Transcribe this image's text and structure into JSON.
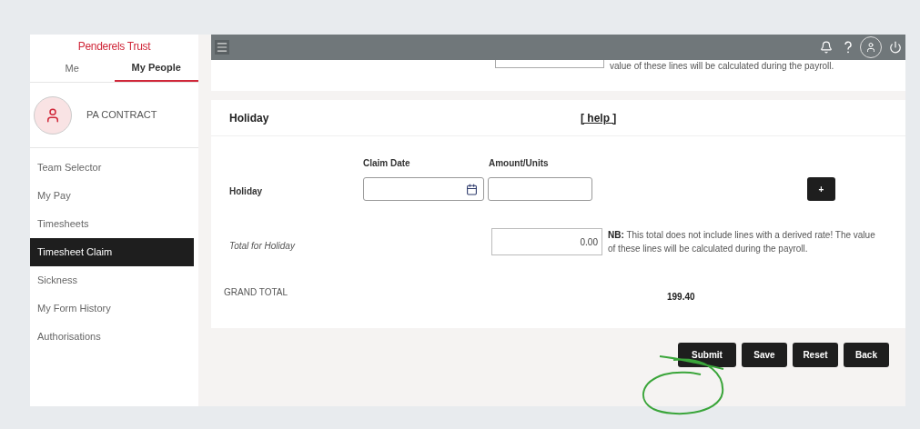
{
  "logo": "Penderels Trust",
  "tabs": [
    {
      "label": "Me",
      "selected": false
    },
    {
      "label": "My People",
      "selected": true
    }
  ],
  "profile": {
    "name": "PA CONTRACT"
  },
  "menu": [
    {
      "label": "Team Selector",
      "selected": false
    },
    {
      "label": "My Pay",
      "selected": false
    },
    {
      "label": "Timesheets",
      "selected": false
    },
    {
      "label": "Timesheet Claim",
      "selected": true
    },
    {
      "label": "Sickness",
      "selected": false
    },
    {
      "label": "My Form History",
      "selected": false
    },
    {
      "label": "Authorisations",
      "selected": false
    }
  ],
  "previous_section": {
    "note": "value of these lines will be calculated during the payroll."
  },
  "section": {
    "title": "Holiday",
    "help": "[ help ]",
    "columns": [
      "Claim Date",
      "Amount/Units"
    ],
    "row_label": "Holiday",
    "add_button": "+",
    "total_label": "Total for Holiday",
    "total_value": "0.00",
    "note_bold": "NB:",
    "note": "This total does not include lines with a derived rate! The value of these lines will be calculated during the payroll."
  },
  "grand_total": {
    "label": "GRAND TOTAL",
    "value": "199.40"
  },
  "buttons": [
    "Submit",
    "Save",
    "Reset",
    "Back"
  ]
}
